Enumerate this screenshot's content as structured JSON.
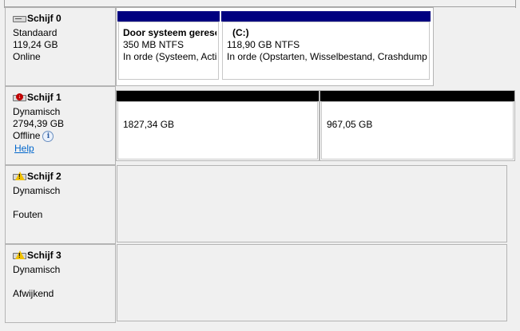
{
  "disks": [
    {
      "name": "Schijf 0",
      "type": "Standaard",
      "size": "119,24 GB",
      "status": "Online",
      "icon": "disk-icon",
      "partitions": [
        {
          "title": "Door systeem gereserveerd",
          "detail": "350 MB NTFS",
          "status": "In orde (Systeem, Actieve, Primaire partitie)",
          "bar_color": "#000080"
        },
        {
          "title": "(C:)",
          "detail": "118,90 GB NTFS",
          "status": "In orde (Opstarten, Wisselbestand, Crashdump, Primaire partitie)",
          "bar_color": "#000080"
        }
      ]
    },
    {
      "name": "Schijf 1",
      "type": "Dynamisch",
      "size": "2794,39 GB",
      "status": "Offline",
      "help": "Help",
      "icon": "disk-error-icon",
      "partitions": [
        {
          "size": "1827,34 GB",
          "bar_color": "#000000"
        },
        {
          "size": "967,05 GB",
          "bar_color": "#000000"
        }
      ]
    },
    {
      "name": "Schijf 2",
      "type": "Dynamisch",
      "status": "Fouten",
      "icon": "disk-warning-icon"
    },
    {
      "name": "Schijf 3",
      "type": "Dynamisch",
      "status": "Afwijkend",
      "icon": "disk-warning-icon"
    }
  ]
}
